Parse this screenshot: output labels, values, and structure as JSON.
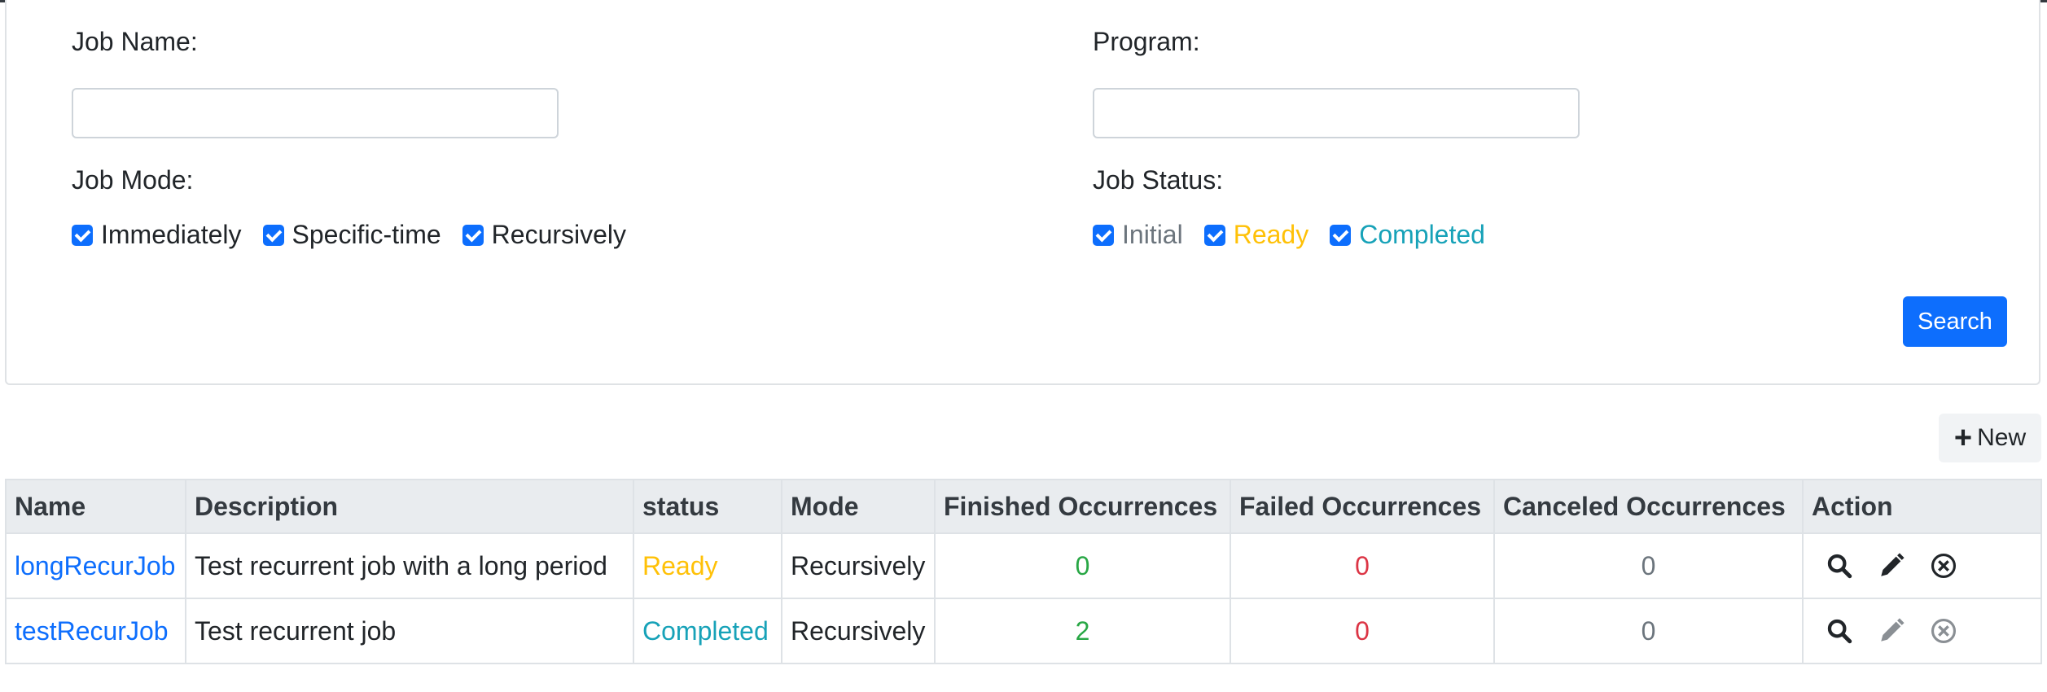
{
  "filters": {
    "job_name": {
      "label": "Job Name:",
      "value": "",
      "placeholder": ""
    },
    "program": {
      "label": "Program:",
      "value": "",
      "placeholder": ""
    },
    "job_mode": {
      "label": "Job Mode:",
      "options": [
        {
          "label": "Immediately",
          "checked": true
        },
        {
          "label": "Specific-time",
          "checked": true
        },
        {
          "label": "Recursively",
          "checked": true
        }
      ]
    },
    "job_status": {
      "label": "Job Status:",
      "options": [
        {
          "label": "Initial",
          "checked": true,
          "color": "#6c757d"
        },
        {
          "label": "Ready",
          "checked": true,
          "color": "#ffc107"
        },
        {
          "label": "Completed",
          "checked": true,
          "color": "#17a2b8"
        }
      ]
    },
    "search_label": "Search"
  },
  "toolbar": {
    "new_label": "New",
    "new_icon": "plus-icon"
  },
  "table": {
    "columns": [
      "Name",
      "Description",
      "status",
      "Mode",
      "Finished Occurrences",
      "Failed Occurrences",
      "Canceled Occurrences",
      "Action"
    ],
    "rows": [
      {
        "name": "longRecurJob",
        "description": "Test recurrent job with a long period",
        "status": "Ready",
        "status_color": "#ffc107",
        "mode": "Recursively",
        "finished": "0",
        "failed": "0",
        "canceled": "0",
        "actions": {
          "view": "search-icon",
          "edit": "pencil-icon",
          "cancel": "cancel-circle-icon",
          "enabled": true
        }
      },
      {
        "name": "testRecurJob",
        "description": "Test recurrent job",
        "status": "Completed",
        "status_color": "#17a2b8",
        "mode": "Recursively",
        "finished": "2",
        "failed": "0",
        "canceled": "0",
        "actions": {
          "view": "search-icon",
          "edit": "pencil-icon",
          "cancel": "cancel-circle-icon",
          "enabled": false
        }
      }
    ]
  },
  "colors": {
    "primary": "#0d6efd",
    "success": "#28a745",
    "danger": "#dc3545",
    "muted": "#6c757d"
  }
}
